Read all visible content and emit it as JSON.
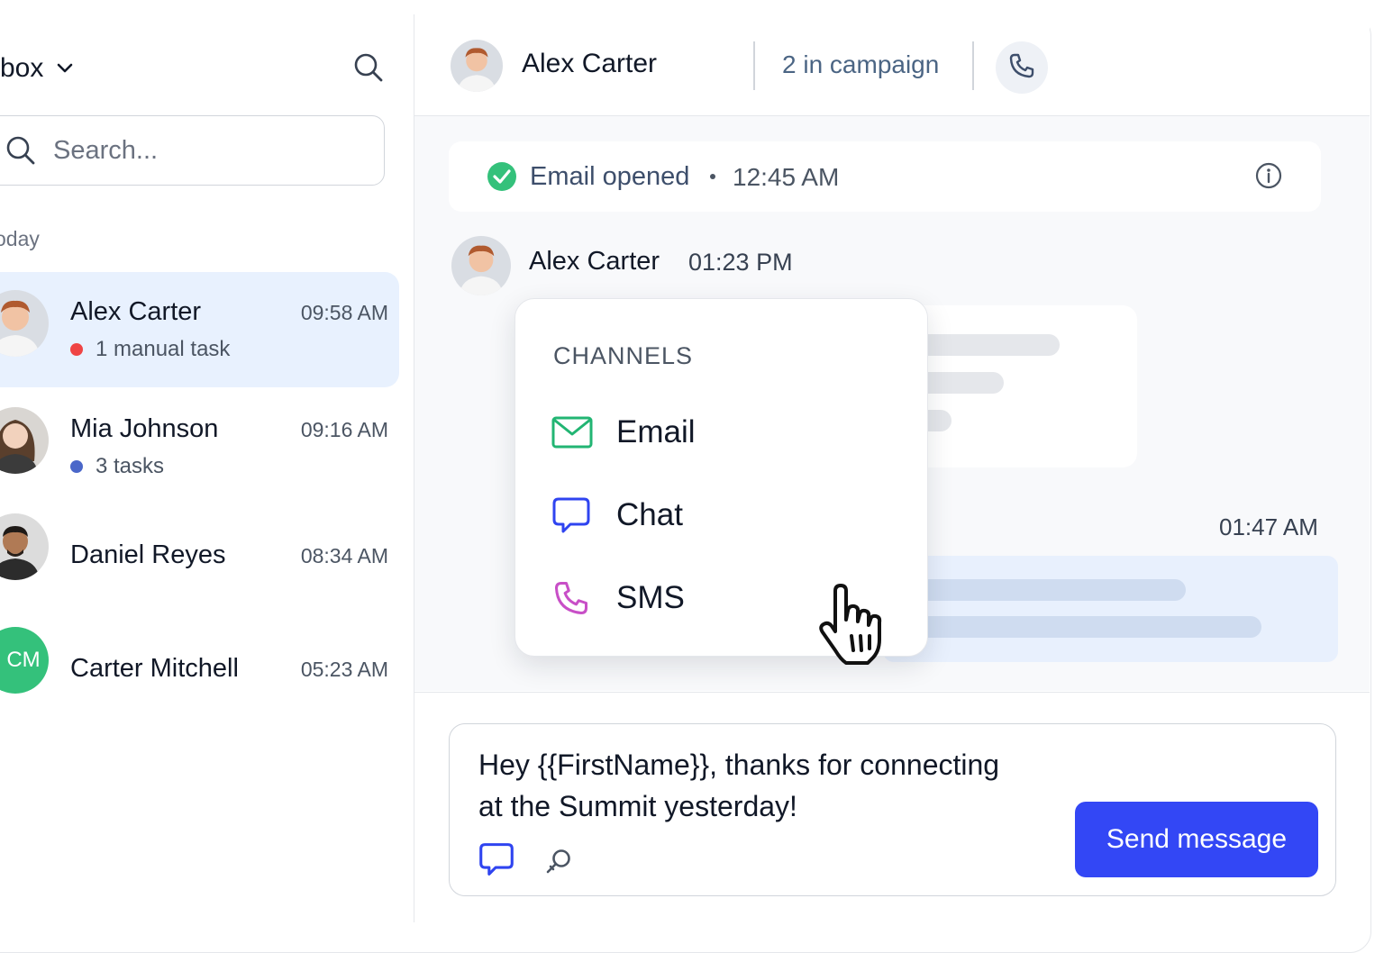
{
  "sidebar": {
    "inbox_label": "box",
    "search_placeholder": "Search...",
    "section_label": "oday",
    "conversations": [
      {
        "name": "Alex Carter",
        "time": "09:58 AM",
        "sub": "1 manual task",
        "dot_color": "#ef4444"
      },
      {
        "name": "Mia Johnson",
        "time": "09:16 AM",
        "sub": "3 tasks",
        "dot_color": "#4a67c9"
      },
      {
        "name": "Daniel Reyes",
        "time": "08:34 AM"
      },
      {
        "name": "Carter Mitchell",
        "time": "05:23 AM",
        "initials": "CM",
        "avatar_color": "#34c17b"
      }
    ]
  },
  "header": {
    "contact_name": "Alex Carter",
    "campaign": "2 in campaign",
    "call_icon": "phone-icon"
  },
  "thread": {
    "event": {
      "text": "Email opened",
      "time": "12:45 AM"
    },
    "message": {
      "sender": "Alex Carter",
      "time": "01:23 PM"
    },
    "outgoing_time": "01:47 AM"
  },
  "channels_menu": {
    "title": "CHANNELS",
    "items": [
      {
        "label": "Email",
        "icon": "mail-icon",
        "color": "#22b573"
      },
      {
        "label": "Chat",
        "icon": "chat-icon",
        "color": "#2f44f0"
      },
      {
        "label": "SMS",
        "icon": "phone-icon",
        "color": "#c84fc7"
      }
    ]
  },
  "composer": {
    "text_line1": "Hey {{FirstName}}, thanks for connecting",
    "text_line2": "at the Summit yesterday!",
    "send_label": "Send message"
  },
  "colors": {
    "accent": "#3347f5",
    "active_row": "#e8f1fe",
    "success": "#34c17b"
  }
}
